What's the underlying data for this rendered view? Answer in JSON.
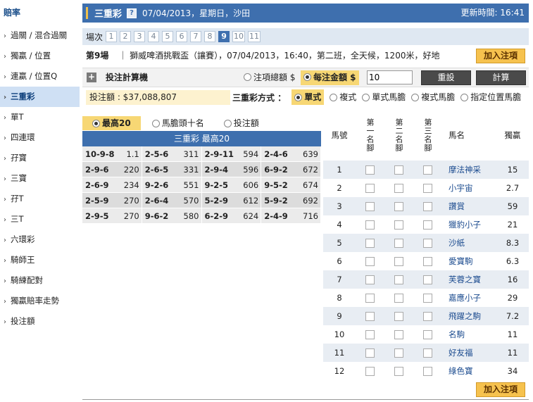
{
  "sidebar": {
    "title": "賠率",
    "items": [
      {
        "label": "過關 / 混合過關",
        "active": false
      },
      {
        "label": "獨贏 / 位置",
        "active": false
      },
      {
        "label": "連贏 / 位置Q",
        "active": false
      },
      {
        "label": "三重彩",
        "active": true
      },
      {
        "label": "單T",
        "active": false
      },
      {
        "label": "四連環",
        "active": false
      },
      {
        "label": "孖寶",
        "active": false
      },
      {
        "label": "三寶",
        "active": false
      },
      {
        "label": "孖T",
        "active": false
      },
      {
        "label": "三T",
        "active": false
      },
      {
        "label": "六環彩",
        "active": false
      },
      {
        "label": "騎師王",
        "active": false
      },
      {
        "label": "騎練配對",
        "active": false
      },
      {
        "label": "獨贏賠率走勢",
        "active": false
      },
      {
        "label": "投注額",
        "active": false
      }
    ]
  },
  "header": {
    "title": "三重彩",
    "help": "?",
    "date": "07/04/2013，星期日，沙田",
    "update_time": "更新時間: 16:41"
  },
  "race_selector": {
    "label": "場次",
    "races": [
      "1",
      "2",
      "3",
      "4",
      "5",
      "6",
      "7",
      "8",
      "9",
      "10",
      "11"
    ],
    "active": "9"
  },
  "race_info": {
    "race_no": "第9場",
    "detail": "｜ 獅威啤酒挑戰盃（讓賽），07/04/2013，16:40，第二班，全天候，1200米，好地"
  },
  "add_bet_label": "加入注項",
  "calculator": {
    "plus": "+",
    "title": "投注計算機",
    "opt_total": "注項總額 $",
    "opt_unit": "每注金額 $",
    "amount": "10",
    "reset_label": "重設",
    "calc_label": "計算"
  },
  "bet_amount": "投注額 : $37,088,807",
  "method": {
    "label": "三重彩方式 ：",
    "options": [
      "單式",
      "複式",
      "單式馬膽",
      "複式馬膽",
      "指定位置馬膽"
    ],
    "selected": "單式"
  },
  "top20_selector": {
    "options": [
      "最高20",
      "馬膽頭十名",
      "投注額"
    ],
    "selected": "最高20"
  },
  "top20_table": {
    "title": "三重彩 最高20",
    "rows": [
      [
        [
          "10-9-8",
          "1.1"
        ],
        [
          "2-5-6",
          "311"
        ],
        [
          "2-9-11",
          "594"
        ],
        [
          "2-4-6",
          "639"
        ]
      ],
      [
        [
          "2-9-6",
          "220"
        ],
        [
          "2-6-5",
          "331"
        ],
        [
          "2-9-4",
          "596"
        ],
        [
          "6-9-2",
          "672"
        ]
      ],
      [
        [
          "2-6-9",
          "234"
        ],
        [
          "9-2-6",
          "551"
        ],
        [
          "9-2-5",
          "606"
        ],
        [
          "9-5-2",
          "674"
        ]
      ],
      [
        [
          "2-5-9",
          "270"
        ],
        [
          "2-6-4",
          "570"
        ],
        [
          "5-2-9",
          "612"
        ],
        [
          "5-9-2",
          "692"
        ]
      ],
      [
        [
          "2-9-5",
          "270"
        ],
        [
          "9-6-2",
          "580"
        ],
        [
          "6-2-9",
          "624"
        ],
        [
          "2-4-9",
          "716"
        ]
      ]
    ]
  },
  "horse_table": {
    "headers": {
      "no": "馬號",
      "first": "第一名腳",
      "second": "第二名腳",
      "third": "第三名腳",
      "name": "馬名",
      "odds": "獨贏"
    },
    "rows": [
      {
        "no": "1",
        "name": "摩法神采",
        "odds": "15"
      },
      {
        "no": "2",
        "name": "小宇宙",
        "odds": "2.7"
      },
      {
        "no": "3",
        "name": "讚賞",
        "odds": "59"
      },
      {
        "no": "4",
        "name": "獵豹小子",
        "odds": "21"
      },
      {
        "no": "5",
        "name": "沙紙",
        "odds": "8.3"
      },
      {
        "no": "6",
        "name": "愛寶駒",
        "odds": "6.3"
      },
      {
        "no": "7",
        "name": "芙蓉之寶",
        "odds": "16"
      },
      {
        "no": "8",
        "name": "嘉應小子",
        "odds": "29"
      },
      {
        "no": "9",
        "name": "飛躍之駒",
        "odds": "7.2"
      },
      {
        "no": "10",
        "name": "名駒",
        "odds": "11"
      },
      {
        "no": "11",
        "name": "好友福",
        "odds": "11"
      },
      {
        "no": "12",
        "name": "綠色寶",
        "odds": "34"
      }
    ]
  },
  "colors": {
    "header_blue": "#3e6fae",
    "highlight_yellow": "#f7d774",
    "add_button": "#f6c24e",
    "active_sidebar": "#cfe0f4"
  }
}
